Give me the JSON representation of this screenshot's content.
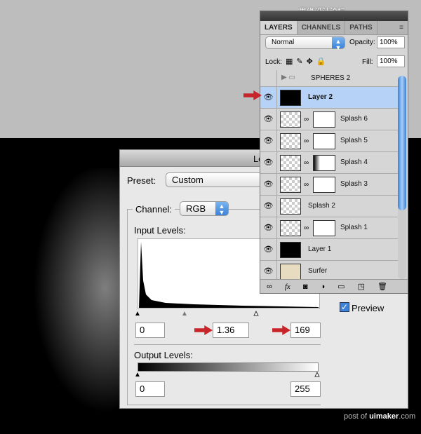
{
  "watermark": "思缘设计论坛 WWW.MISSYUAN.COM",
  "credit": {
    "prefix": "post of ",
    "brand": "uimaker",
    ".suffix": ".com",
    "suffix": ".com"
  },
  "levels": {
    "title": "Le",
    "preset_label": "Preset:",
    "preset_value": "Custom",
    "channel_label": "Channel:",
    "channel_value": "RGB",
    "input_label": "Input Levels:",
    "input_black": "0",
    "input_gamma": "1.36",
    "input_white": "169",
    "output_label": "Output Levels:",
    "output_black": "0",
    "output_white": "255",
    "preview_label": "Preview",
    "preview_checked": true
  },
  "layers": {
    "tabs": [
      "LAYERS",
      "CHANNELS",
      "PATHS"
    ],
    "blend_mode": "Normal",
    "opacity_label": "Opacity:",
    "opacity": "100%",
    "lock_label": "Lock:",
    "fill_label": "Fill:",
    "fill": "100%",
    "items": [
      {
        "name": "SPHERES 2",
        "type": "group",
        "visible": false
      },
      {
        "name": "Layer 2",
        "selected": true,
        "visible": true
      },
      {
        "name": "Splash 6",
        "mask": true,
        "visible": true
      },
      {
        "name": "Splash 5",
        "mask": true,
        "visible": true
      },
      {
        "name": "Splash 4",
        "mask": true,
        "visible": true
      },
      {
        "name": "Splash 3",
        "mask": true,
        "visible": true
      },
      {
        "name": "Splash 2",
        "visible": true
      },
      {
        "name": "Splash 1",
        "mask": true,
        "visible": true
      },
      {
        "name": "Layer 1",
        "visible": true
      },
      {
        "name": "Surfer",
        "visible": true
      }
    ],
    "footer_icons": [
      "link-icon",
      "fx-icon",
      "mask-icon",
      "adjustment-icon",
      "folder-icon",
      "new-layer-icon",
      "trash-icon"
    ]
  },
  "colors": {
    "arrow": "#c8252a",
    "selection": "#b6d3f7",
    "accent": "#3c82d8"
  }
}
